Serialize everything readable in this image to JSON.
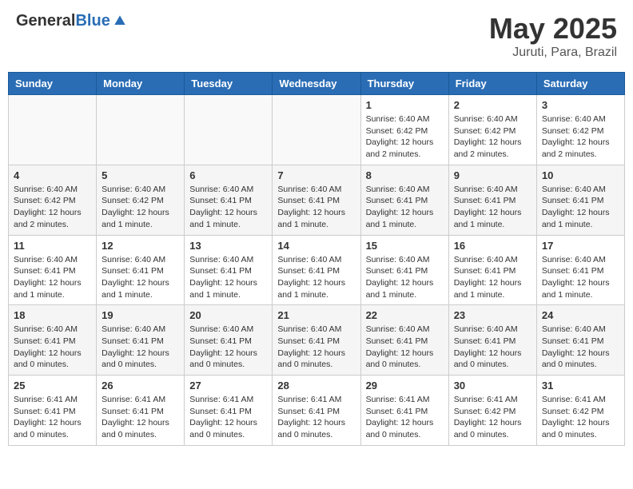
{
  "header": {
    "logo_general": "General",
    "logo_blue": "Blue",
    "month_title": "May 2025",
    "location": "Juruti, Para, Brazil"
  },
  "days_of_week": [
    "Sunday",
    "Monday",
    "Tuesday",
    "Wednesday",
    "Thursday",
    "Friday",
    "Saturday"
  ],
  "weeks": [
    [
      {
        "day": "",
        "info": ""
      },
      {
        "day": "",
        "info": ""
      },
      {
        "day": "",
        "info": ""
      },
      {
        "day": "",
        "info": ""
      },
      {
        "day": "1",
        "info": "Sunrise: 6:40 AM\nSunset: 6:42 PM\nDaylight: 12 hours\nand 2 minutes."
      },
      {
        "day": "2",
        "info": "Sunrise: 6:40 AM\nSunset: 6:42 PM\nDaylight: 12 hours\nand 2 minutes."
      },
      {
        "day": "3",
        "info": "Sunrise: 6:40 AM\nSunset: 6:42 PM\nDaylight: 12 hours\nand 2 minutes."
      }
    ],
    [
      {
        "day": "4",
        "info": "Sunrise: 6:40 AM\nSunset: 6:42 PM\nDaylight: 12 hours\nand 2 minutes."
      },
      {
        "day": "5",
        "info": "Sunrise: 6:40 AM\nSunset: 6:42 PM\nDaylight: 12 hours\nand 1 minute."
      },
      {
        "day": "6",
        "info": "Sunrise: 6:40 AM\nSunset: 6:41 PM\nDaylight: 12 hours\nand 1 minute."
      },
      {
        "day": "7",
        "info": "Sunrise: 6:40 AM\nSunset: 6:41 PM\nDaylight: 12 hours\nand 1 minute."
      },
      {
        "day": "8",
        "info": "Sunrise: 6:40 AM\nSunset: 6:41 PM\nDaylight: 12 hours\nand 1 minute."
      },
      {
        "day": "9",
        "info": "Sunrise: 6:40 AM\nSunset: 6:41 PM\nDaylight: 12 hours\nand 1 minute."
      },
      {
        "day": "10",
        "info": "Sunrise: 6:40 AM\nSunset: 6:41 PM\nDaylight: 12 hours\nand 1 minute."
      }
    ],
    [
      {
        "day": "11",
        "info": "Sunrise: 6:40 AM\nSunset: 6:41 PM\nDaylight: 12 hours\nand 1 minute."
      },
      {
        "day": "12",
        "info": "Sunrise: 6:40 AM\nSunset: 6:41 PM\nDaylight: 12 hours\nand 1 minute."
      },
      {
        "day": "13",
        "info": "Sunrise: 6:40 AM\nSunset: 6:41 PM\nDaylight: 12 hours\nand 1 minute."
      },
      {
        "day": "14",
        "info": "Sunrise: 6:40 AM\nSunset: 6:41 PM\nDaylight: 12 hours\nand 1 minute."
      },
      {
        "day": "15",
        "info": "Sunrise: 6:40 AM\nSunset: 6:41 PM\nDaylight: 12 hours\nand 1 minute."
      },
      {
        "day": "16",
        "info": "Sunrise: 6:40 AM\nSunset: 6:41 PM\nDaylight: 12 hours\nand 1 minute."
      },
      {
        "day": "17",
        "info": "Sunrise: 6:40 AM\nSunset: 6:41 PM\nDaylight: 12 hours\nand 1 minute."
      }
    ],
    [
      {
        "day": "18",
        "info": "Sunrise: 6:40 AM\nSunset: 6:41 PM\nDaylight: 12 hours\nand 0 minutes."
      },
      {
        "day": "19",
        "info": "Sunrise: 6:40 AM\nSunset: 6:41 PM\nDaylight: 12 hours\nand 0 minutes."
      },
      {
        "day": "20",
        "info": "Sunrise: 6:40 AM\nSunset: 6:41 PM\nDaylight: 12 hours\nand 0 minutes."
      },
      {
        "day": "21",
        "info": "Sunrise: 6:40 AM\nSunset: 6:41 PM\nDaylight: 12 hours\nand 0 minutes."
      },
      {
        "day": "22",
        "info": "Sunrise: 6:40 AM\nSunset: 6:41 PM\nDaylight: 12 hours\nand 0 minutes."
      },
      {
        "day": "23",
        "info": "Sunrise: 6:40 AM\nSunset: 6:41 PM\nDaylight: 12 hours\nand 0 minutes."
      },
      {
        "day": "24",
        "info": "Sunrise: 6:40 AM\nSunset: 6:41 PM\nDaylight: 12 hours\nand 0 minutes."
      }
    ],
    [
      {
        "day": "25",
        "info": "Sunrise: 6:41 AM\nSunset: 6:41 PM\nDaylight: 12 hours\nand 0 minutes."
      },
      {
        "day": "26",
        "info": "Sunrise: 6:41 AM\nSunset: 6:41 PM\nDaylight: 12 hours\nand 0 minutes."
      },
      {
        "day": "27",
        "info": "Sunrise: 6:41 AM\nSunset: 6:41 PM\nDaylight: 12 hours\nand 0 minutes."
      },
      {
        "day": "28",
        "info": "Sunrise: 6:41 AM\nSunset: 6:41 PM\nDaylight: 12 hours\nand 0 minutes."
      },
      {
        "day": "29",
        "info": "Sunrise: 6:41 AM\nSunset: 6:41 PM\nDaylight: 12 hours\nand 0 minutes."
      },
      {
        "day": "30",
        "info": "Sunrise: 6:41 AM\nSunset: 6:42 PM\nDaylight: 12 hours\nand 0 minutes."
      },
      {
        "day": "31",
        "info": "Sunrise: 6:41 AM\nSunset: 6:42 PM\nDaylight: 12 hours\nand 0 minutes."
      }
    ]
  ]
}
